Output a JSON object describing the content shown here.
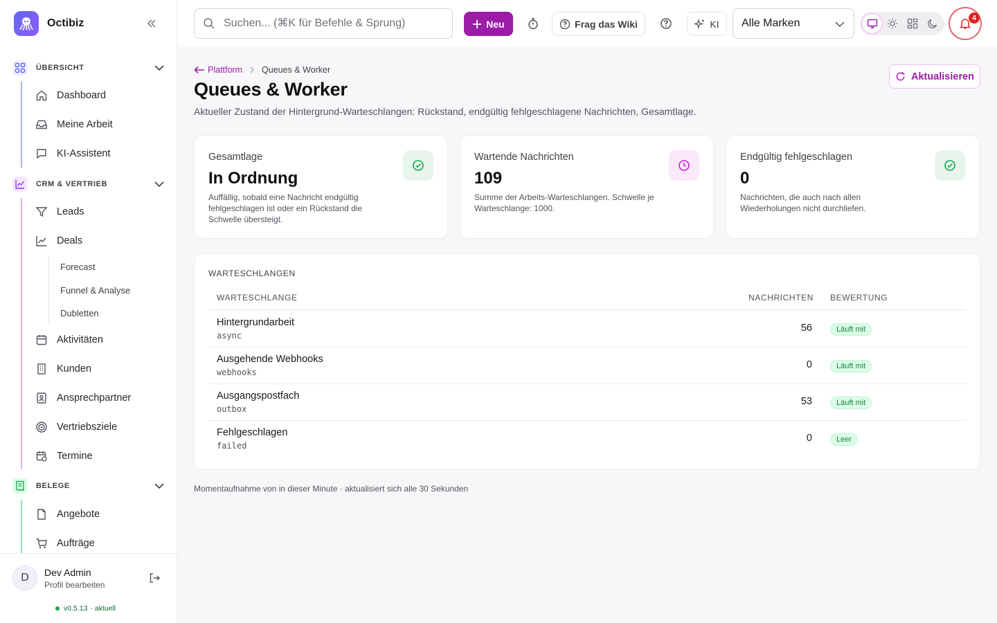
{
  "app": {
    "name": "Octibiz"
  },
  "sidebar": {
    "sections": [
      {
        "label": "ÜBERSICHT",
        "items": [
          "Dashboard",
          "Meine Arbeit",
          "KI-Assistent"
        ]
      },
      {
        "label": "CRM & VERTRIEB",
        "items": [
          "Leads",
          "Deals",
          "Aktivitäten",
          "Kunden",
          "Ansprechpartner",
          "Vertriebsziele",
          "Termine"
        ],
        "deal_subitems": [
          "Forecast",
          "Funnel & Analyse",
          "Dubletten"
        ]
      },
      {
        "label": "BELEGE",
        "items": [
          "Angebote",
          "Aufträge"
        ]
      }
    ],
    "profile": {
      "initial": "D",
      "name": "Dev Admin",
      "sub": "Profil bearbeiten",
      "version": "v0.5.13",
      "version_status": "· aktuell"
    }
  },
  "topbar": {
    "search_placeholder": "Suchen... (⌘K für Befehle & Sprung)",
    "new_label": "Neu",
    "wiki_label": "Frag das Wiki",
    "ai_label": "KI",
    "brand_select": "Alle Marken",
    "notification_count": "4"
  },
  "page": {
    "breadcrumb_parent": "Plattform",
    "breadcrumb_current": "Queues & Worker",
    "title": "Queues & Worker",
    "description": "Aktueller Zustand der Hintergrund-Warteschlangen: Rückstand, endgültig fehlgeschlagene Nachrichten, Gesamtlage.",
    "refresh_label": "Aktualisieren"
  },
  "cards": [
    {
      "label": "Gesamtlage",
      "value": "In Ordnung",
      "note": "Auffällig, sobald eine Nachricht endgültig fehlgeschlagen ist oder ein Rückstand die Schwelle übersteigt.",
      "icon": "check-circle-icon"
    },
    {
      "label": "Wartende Nachrichten",
      "value": "109",
      "note": "Summe der Arbeits-Warteschlangen. Schwelle je Warteschlange: 1000.",
      "icon": "clock-icon"
    },
    {
      "label": "Endgültig fehlgeschlagen",
      "value": "0",
      "note": "Nachrichten, die auch nach allen Wiederholungen nicht durchliefen.",
      "icon": "check-circle-icon"
    }
  ],
  "queues": {
    "title": "WARTESCHLANGEN",
    "headers": {
      "name": "WARTESCHLANGE",
      "count": "NACHRICHTEN",
      "status": "BEWERTUNG"
    },
    "rows": [
      {
        "name": "Hintergrundarbeit",
        "key": "async",
        "count": "56",
        "status": "Läuft mit"
      },
      {
        "name": "Ausgehende Webhooks",
        "key": "webhooks",
        "count": "0",
        "status": "Läuft mit"
      },
      {
        "name": "Ausgangspostfach",
        "key": "outbox",
        "count": "53",
        "status": "Läuft mit"
      },
      {
        "name": "Fehlgeschlagen",
        "key": "failed",
        "count": "0",
        "status": "Leer"
      }
    ]
  },
  "footer_note": "Momentaufnahme von in dieser Minute · aktualisiert sich alle 30 Sekunden",
  "colors": {
    "accent": "#9c1ca8",
    "success": "#16a34a",
    "danger": "#dc2626"
  }
}
